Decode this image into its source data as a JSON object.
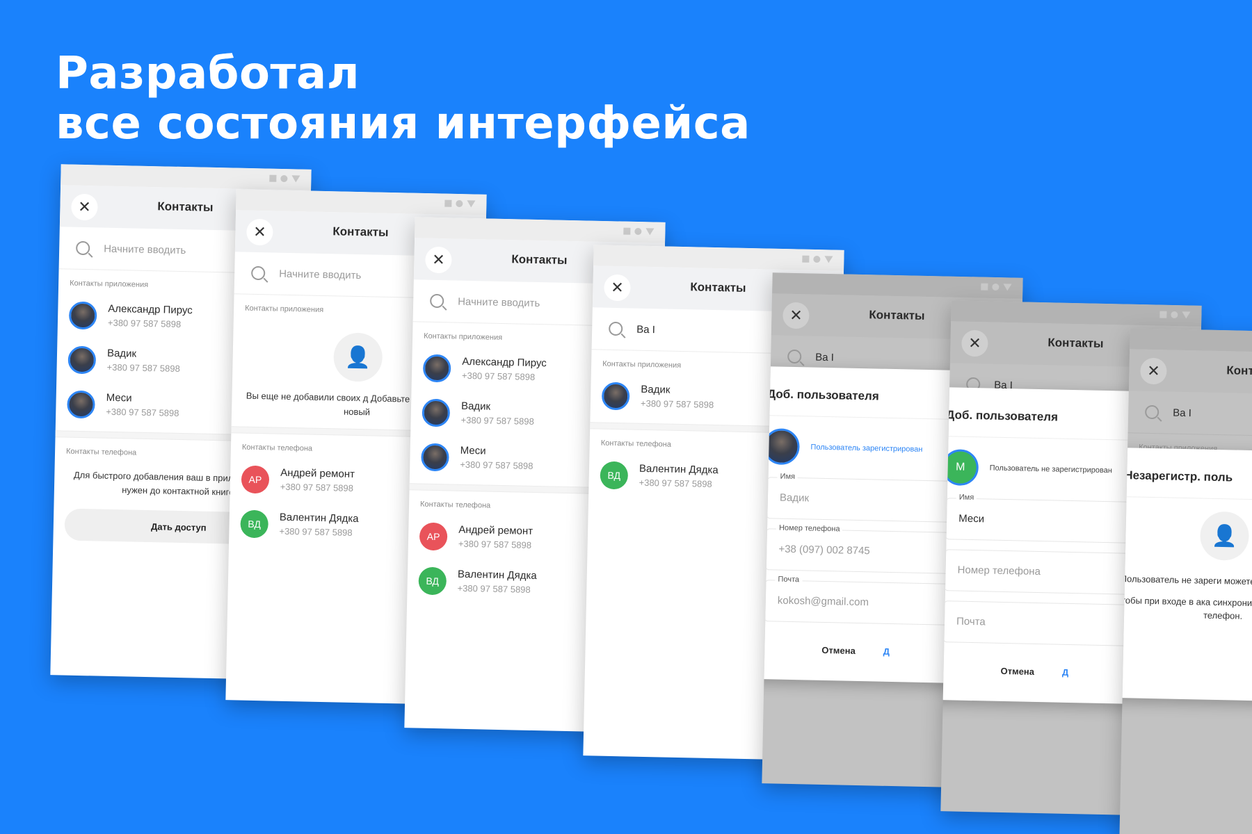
{
  "headline": {
    "line1": "Разработал",
    "line2": "все состояния интерфейса"
  },
  "app": {
    "title": "Контакты",
    "search_placeholder": "Начните вводить",
    "typed_query": "Ва I",
    "section_app": "Контакты приложения",
    "section_phone": "Контакты телефона"
  },
  "contacts_app": [
    {
      "name": "Александр Пирус",
      "phone": "+380 97 587 5898"
    },
    {
      "name": "Вадик",
      "phone": "+380 97 587 5898"
    },
    {
      "name": "Меси",
      "phone": "+380 97 587 5898"
    }
  ],
  "contacts_phone": [
    {
      "initials": "АР",
      "name": "Андрей ремонт",
      "phone": "+380 97 587 5898"
    },
    {
      "initials": "ВД",
      "name": "Валентин Дядка",
      "phone": "+380 97 587 5898"
    }
  ],
  "permission": {
    "text": "Для быстрого добавления ваш в приложение, нам нужен до контактной книге)",
    "button": "Дать доступ"
  },
  "empty_state": {
    "text": "Вы еще не добавили своих д Добавьте или создайте новый"
  },
  "filtered": {
    "app_contact": {
      "name": "Вадик",
      "phone": "+380 97 587 5898"
    },
    "phone_contact": {
      "name": "Валентин Дядка",
      "phone": "+380 97 587 5898"
    }
  },
  "modal_registered": {
    "title": "Доб. пользователя",
    "status": "Пользователь зарегистрирован",
    "name_label": "Имя",
    "name_value": "Вадик",
    "phone_label": "Номер телефона",
    "phone_value": "+38 (097) 002 8745",
    "email_label": "Почта",
    "email_value": "kokosh@gmail.com",
    "cancel": "Отмена",
    "add": "Д"
  },
  "modal_unregistered": {
    "title": "Доб. пользователя",
    "initial": "М",
    "status": "Пользователь не зарегистрирован",
    "name_label": "Имя",
    "name_value": "Меси",
    "phone_placeholder": "Номер телефона",
    "email_placeholder": "Почта",
    "cancel": "Отмена",
    "add": "Д"
  },
  "modal_info": {
    "title": "Незарегистр. поль",
    "text1": "Пользователь не зареги можете добавлять общи",
    "text2": "Чтобы при входе в ака синхронизировались доба и телефон."
  },
  "colors": {
    "background": "#1A82FC",
    "accent": "#2E86F5",
    "avatar_red": "#E9535A",
    "avatar_green": "#3BB55A"
  }
}
